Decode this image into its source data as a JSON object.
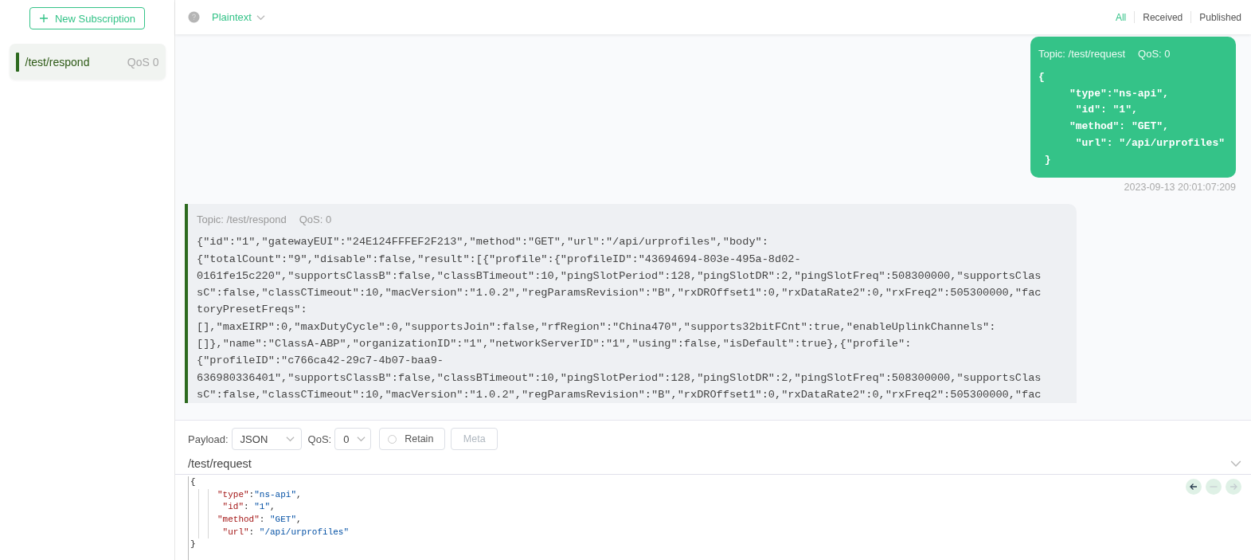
{
  "sidebar": {
    "new_button": "New Subscription",
    "subscriptions": [
      {
        "topic": "/test/respond",
        "qos": "QoS 0",
        "color": "#2d6a1f",
        "selected": true
      }
    ]
  },
  "header": {
    "format": "Plaintext",
    "filters": [
      {
        "label": "All",
        "selected": true
      },
      {
        "label": "Received",
        "selected": false
      },
      {
        "label": "Published",
        "selected": false
      }
    ]
  },
  "messages": [
    {
      "kind": "published",
      "topic": "Topic: /test/request",
      "qos": "QoS: 0",
      "time": "2023-09-13 20:01:07:209",
      "lines": [
        "{",
        "     \"type\":\"ns-api\",",
        "      \"id\": \"1\",",
        "     \"method\": \"GET\",",
        "      \"url\": \"/api/urprofiles\"",
        " }"
      ]
    },
    {
      "kind": "received",
      "topic": "Topic: /test/respond",
      "qos": "QoS: 0",
      "color": "#2d6a1f",
      "lines": [
        "{\"id\":\"1\",\"gatewayEUI\":\"24E124FFFEF2F213\",\"method\":\"GET\",\"url\":\"/api/urprofiles\",\"body\":",
        "{\"totalCount\":\"9\",\"disable\":false,\"result\":[{\"profile\":{\"profileID\":\"43694694-803e-495a-8d02-",
        "0161fe15c220\",\"supportsClassB\":false,\"classBTimeout\":10,\"pingSlotPeriod\":128,\"pingSlotDR\":2,\"pingSlotFreq\":508300000,\"supportsClas",
        "sC\":false,\"classCTimeout\":10,\"macVersion\":\"1.0.2\",\"regParamsRevision\":\"B\",\"rxDROffset1\":0,\"rxDataRate2\":0,\"rxFreq2\":505300000,\"fac",
        "toryPresetFreqs\":",
        "[],\"maxEIRP\":0,\"maxDutyCycle\":0,\"supportsJoin\":false,\"rfRegion\":\"China470\",\"supports32bitFCnt\":true,\"enableUplinkChannels\":",
        "[]},\"name\":\"ClassA-ABP\",\"organizationID\":\"1\",\"networkServerID\":\"1\",\"using\":false,\"isDefault\":true},{\"profile\":",
        "{\"profileID\":\"c766ca42-29c7-4b07-baa9-",
        "636980336401\",\"supportsClassB\":false,\"classBTimeout\":10,\"pingSlotPeriod\":128,\"pingSlotDR\":2,\"pingSlotFreq\":508300000,\"supportsClas",
        "sC\":false,\"classCTimeout\":10,\"macVersion\":\"1.0.2\",\"regParamsRevision\":\"B\",\"rxDROffset1\":0,\"rxDataRate2\":0,\"rxFreq2\":505300000,\"fac"
      ]
    }
  ],
  "composer": {
    "payload_label": "Payload:",
    "payload_format": "JSON",
    "qos_label": "QoS:",
    "qos": "0",
    "retain": {
      "label": "Retain",
      "checked": false
    },
    "meta_button": "Meta",
    "topic": "/test/request",
    "code": {
      "open": "{",
      "close": "}",
      "children": [
        {
          "tokens": [
            {
              "kind": "key",
              "text": "\"type\""
            },
            {
              "kind": "punct",
              "text": ":"
            },
            {
              "kind": "value",
              "text": "\"ns-api\""
            },
            {
              "kind": "punct",
              "text": ","
            }
          ]
        },
        {
          "tokens": [
            {
              "kind": "key",
              "text": " \"id\""
            },
            {
              "kind": "punct",
              "text": ": "
            },
            {
              "kind": "value",
              "text": "\"1\""
            },
            {
              "kind": "punct",
              "text": ","
            }
          ]
        },
        {
          "tokens": [
            {
              "kind": "key",
              "text": "\"method\""
            },
            {
              "kind": "punct",
              "text": ": "
            },
            {
              "kind": "value",
              "text": "\"GET\""
            },
            {
              "kind": "punct",
              "text": ","
            }
          ]
        },
        {
          "tokens": [
            {
              "kind": "key",
              "text": " \"url\""
            },
            {
              "kind": "punct",
              "text": ": "
            },
            {
              "kind": "value",
              "text": "\"/api/urprofiles\""
            }
          ]
        }
      ]
    },
    "history": [
      {
        "kind": "back",
        "disabled": false
      },
      {
        "kind": "current",
        "disabled": true
      },
      {
        "kind": "forward",
        "disabled": true
      }
    ]
  }
}
